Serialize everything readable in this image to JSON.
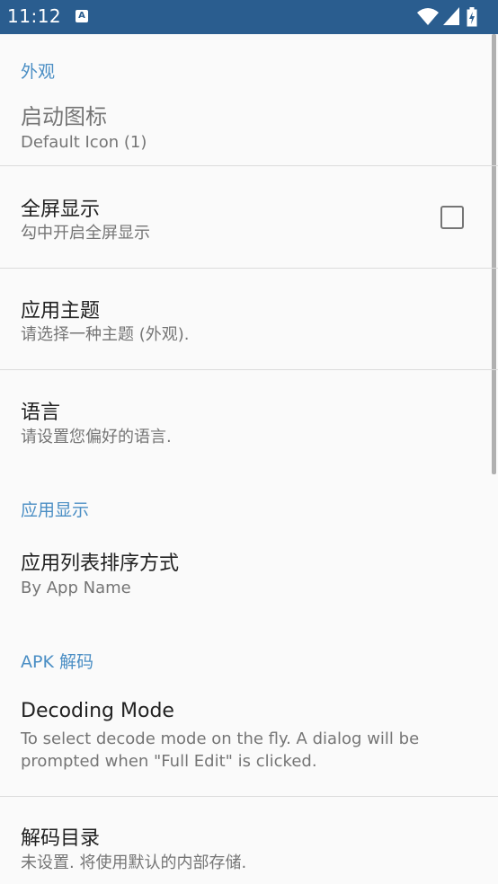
{
  "status_bar": {
    "time": "11:12",
    "notification_glyph": "A",
    "icons": [
      "wifi-icon",
      "cellular-signal-icon",
      "battery-icon"
    ]
  },
  "categories": {
    "appearance": "外观",
    "app_display": "应用显示",
    "apk_decode": "APK 解码"
  },
  "prefs": {
    "launch_icon": {
      "title": "启动图标",
      "summary": "Default Icon (1)"
    },
    "fullscreen": {
      "title": "全屏显示",
      "summary": "勾中开启全屏显示",
      "checked": false
    },
    "theme": {
      "title": "应用主题",
      "summary": "请选择一种主题 (外观)."
    },
    "language": {
      "title": "语言",
      "summary": "请设置您偏好的语言."
    },
    "sort": {
      "title": "应用列表排序方式",
      "summary": "By App Name"
    },
    "decoding_mode": {
      "title": "Decoding Mode",
      "summary": "To select decode mode on the fly. A dialog will be prompted when \"Full Edit\" is clicked."
    },
    "decode_dir": {
      "title": "解码目录",
      "summary": "未设置. 将使用默认的内部存储."
    }
  },
  "colors": {
    "status_bar": "#2a5d8f",
    "category_accent": "#4a8ec4",
    "background": "#fafafa"
  }
}
